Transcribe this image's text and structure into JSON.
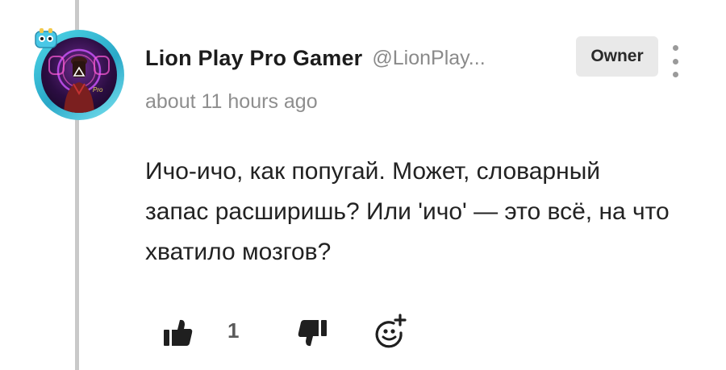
{
  "comment": {
    "author": "Lion Play Pro Gamer",
    "handle": "@LionPlay...",
    "badge": "Owner",
    "timestamp": "about 11 hours ago",
    "text": "Ичо-ичо, как попугай. Может, словарный запас расширишь? Или 'ичо' — это всё, на что хватило мозгов?",
    "likes": "1"
  },
  "icons": {
    "avatar": "avatar-image",
    "more": "more-vertical-icon",
    "like": "thumbs-up-icon",
    "dislike": "thumbs-down-icon",
    "react": "add-reaction-icon"
  },
  "colors": {
    "accent_ring": "#2aa8c8",
    "badge_bg": "#e9e9e9",
    "muted_text": "#8e8e8e",
    "icon": "#1f1f1f"
  }
}
